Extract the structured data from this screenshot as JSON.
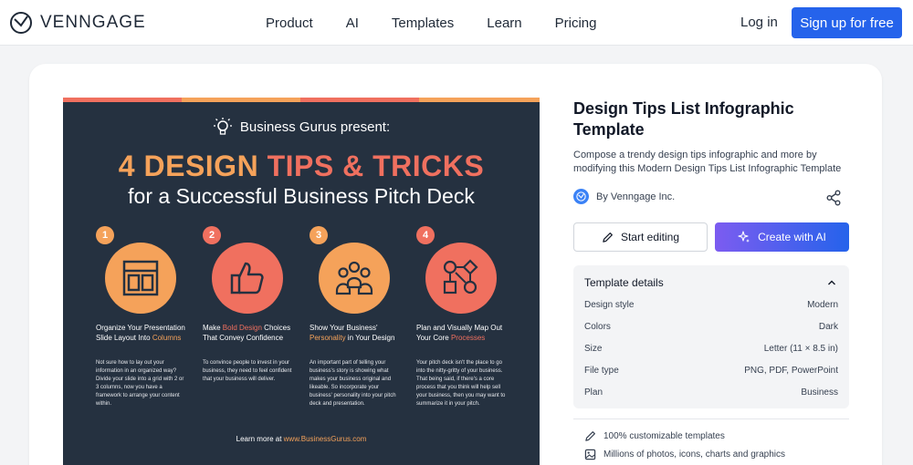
{
  "header": {
    "brand": "VENNGAGE",
    "nav": [
      "Product",
      "AI",
      "Templates",
      "Learn",
      "Pricing"
    ],
    "login": "Log in",
    "signup": "Sign up for free"
  },
  "infographic": {
    "present": "Business Gurus present:",
    "headline_part1": "4 DESIGN ",
    "headline_part2": "TIPS & TRICKS",
    "subheadline": "for a Successful Business Pitch Deck",
    "columns": [
      {
        "num": "1",
        "title_pre": "Organize Your Presentation Slide Layout Into ",
        "title_hl": "Columns",
        "title_post": "",
        "body": "Not sure how to lay out your information in an organized way? Divide your slide into a grid with 2 or 3 columns, now you have a framework to arrange your content within."
      },
      {
        "num": "2",
        "title_pre": "Make ",
        "title_hl": "Bold Design",
        "title_post": " Choices That Convey Confidence",
        "body": "To convince people to invest in your business, they need to feel confident that your business will deliver."
      },
      {
        "num": "3",
        "title_pre": "Show Your Business' ",
        "title_hl": "Personality",
        "title_post": " in Your Design",
        "body": "An important part of telling your business's story is showing what makes your business original and likeable. So incorporate your business' personality into your pitch deck and presentation."
      },
      {
        "num": "4",
        "title_pre": "Plan and Visually Map Out Your Core ",
        "title_hl": "Processes",
        "title_post": "",
        "body": "Your pitch deck isn't the place to go into the nitty-gritty of your business. That being said, if there's a core process that you think will help sell your business, then you may want to summarize it in your pitch."
      }
    ],
    "learn_pre": "Learn more at ",
    "learn_link": "www.BusinessGurus.com"
  },
  "panel": {
    "title": "Design Tips List Infographic Template",
    "description": "Compose a trendy design tips infographic and more by modifying this Modern Design Tips List Infographic Template",
    "author": "By Venngage Inc.",
    "start_editing": "Start editing",
    "create_ai": "Create with AI",
    "details_title": "Template details",
    "details": [
      {
        "key": "Design style",
        "value": "Modern"
      },
      {
        "key": "Colors",
        "value": "Dark"
      },
      {
        "key": "Size",
        "value": "Letter (11 × 8.5 in)"
      },
      {
        "key": "File type",
        "value": "PNG, PDF, PowerPoint"
      },
      {
        "key": "Plan",
        "value": "Business"
      }
    ],
    "features": [
      "100% customizable templates",
      "Millions of photos, icons, charts and graphics"
    ]
  },
  "colors": {
    "accent": "#2563eb",
    "infographic_bg": "#253140",
    "orange": "#f5a25a",
    "coral": "#f0705f"
  }
}
